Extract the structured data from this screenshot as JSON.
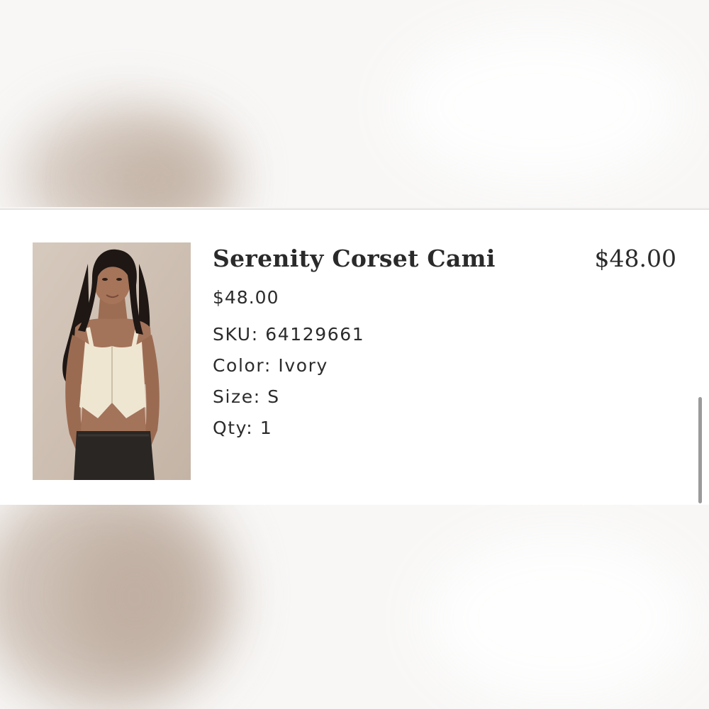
{
  "product": {
    "name": "Serenity Corset Cami",
    "unit_price": "$48.00",
    "line_total": "$48.00",
    "image_alt": "Model wearing Serenity Corset Cami in ivory"
  },
  "details": [
    {
      "label": "SKU:",
      "value": "64129661"
    },
    {
      "label": "Color:",
      "value": "Ivory"
    },
    {
      "label": "Size:",
      "value": "S"
    },
    {
      "label": "Qty:",
      "value": "1"
    }
  ],
  "colors": {
    "text": "#2a2a2a",
    "card_bg": "#ffffff",
    "page_bg": "#f7f5f3",
    "scrollbar": "#9b9b9b"
  }
}
